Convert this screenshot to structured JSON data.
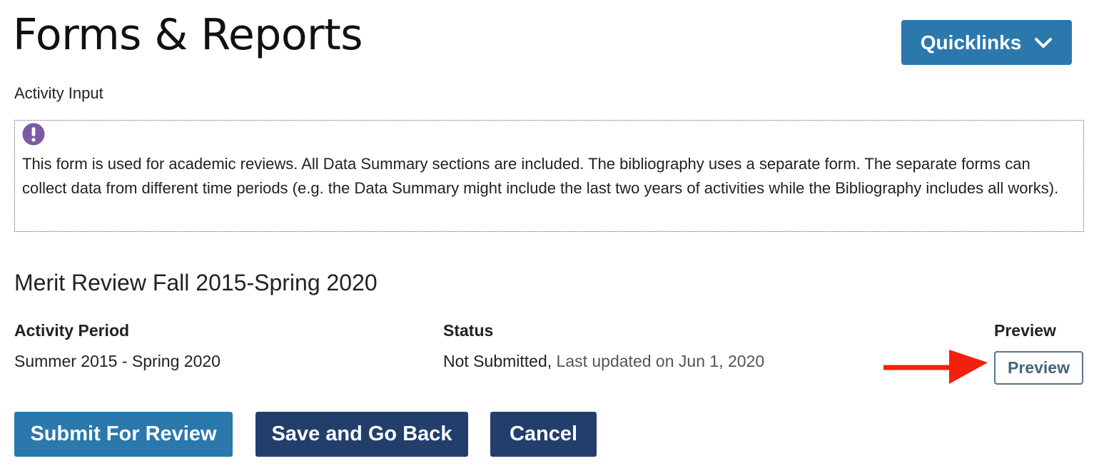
{
  "header": {
    "title": "Forms & Reports",
    "quicklinks_label": "Quicklinks",
    "quicklinks_icon": "chevron-down-icon"
  },
  "form": {
    "subheading": "Activity Input",
    "notice": {
      "icon": "exclamation-circle-icon",
      "icon_color": "#7b5aa6",
      "text": "This form is used for academic reviews. All Data Summary sections are included. The bibliography uses a separate form. The separate forms can collect data from different time periods  (e.g. the Data Summary might include the last two years of activities while the Bibliography includes all works)."
    }
  },
  "review": {
    "title": "Merit Review Fall 2015-Spring 2020",
    "columns": {
      "activity_period": "Activity Period",
      "status": "Status",
      "preview": "Preview"
    },
    "row": {
      "activity_period": "Summer 2015 - Spring 2020",
      "status": "Not Submitted,",
      "last_updated": "Last updated on Jun 1, 2020",
      "preview_button": "Preview"
    }
  },
  "actions": {
    "submit": "Submit For Review",
    "save_back": "Save and Go Back",
    "cancel": "Cancel"
  },
  "annotation": {
    "arrow_color": "#f2200c",
    "arrow_icon": "arrow-right-icon"
  },
  "colors": {
    "primary": "#2b78ad",
    "dark": "#223f6c",
    "outline": "#5b7588"
  }
}
